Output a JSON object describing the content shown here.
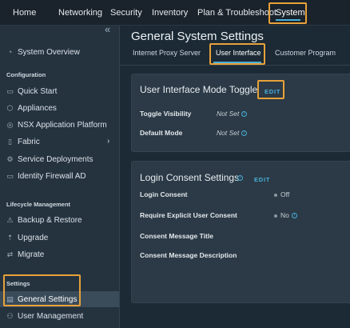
{
  "topnav": {
    "items": [
      "Home",
      "Networking",
      "Security",
      "Inventory",
      "Plan & Troubleshoot",
      "System"
    ],
    "active": "System"
  },
  "sidebar": {
    "collapse_glyph": "«",
    "overview": "System Overview",
    "sections": {
      "configuration": "Configuration",
      "lifecycle": "Lifecycle Management",
      "settings": "Settings"
    },
    "items": {
      "quick_start": "Quick Start",
      "appliances": "Appliances",
      "nsx_app_platform": "NSX Application Platform",
      "fabric": "Fabric",
      "service_deployments": "Service Deployments",
      "identity_firewall": "Identity Firewall AD",
      "backup_restore": "Backup & Restore",
      "upgrade": "Upgrade",
      "migrate": "Migrate",
      "general_settings": "General Settings",
      "user_management": "User Management"
    }
  },
  "main": {
    "title": "General System Settings",
    "tabs": [
      "Internet Proxy Server",
      "User Interface",
      "Customer Program"
    ],
    "active_tab": "User Interface",
    "ui_mode_card": {
      "title": "User Interface Mode Toggle",
      "edit": "EDIT",
      "rows": [
        {
          "label": "Toggle Visibility",
          "value": "Not Set"
        },
        {
          "label": "Default Mode",
          "value": "Not Set"
        }
      ]
    },
    "consent_card": {
      "title": "Login Consent Settings",
      "edit": "EDIT",
      "rows": [
        {
          "label": "Login Consent",
          "value": "Off"
        },
        {
          "label": "Require Explicit User Consent",
          "value": "No"
        },
        {
          "label": "Consent Message Title",
          "value": ""
        },
        {
          "label": "Consent Message Description",
          "value": ""
        }
      ]
    }
  },
  "colors": {
    "accent": "#49afd9",
    "highlight": "#e8a13a",
    "background": "#1b2a35",
    "sidebar": "#25333f",
    "card": "#2b3a46"
  }
}
